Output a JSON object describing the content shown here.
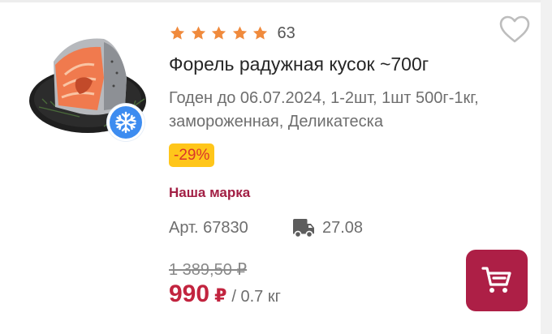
{
  "product": {
    "rating_count": "63",
    "rating_value": 5,
    "title": "Форель радужная кусок ~700г",
    "description": "Годен до 06.07.2024, 1-2шт, 1шт 500г-1кг, замороженная, Деликатеска",
    "discount": "-29%",
    "brand": "Наша марка",
    "article": "Арт. 67830",
    "delivery_date": "27.08",
    "old_price": "1 389,50 ₽",
    "price": "990",
    "currency": "₽",
    "price_unit": "/ 0.7 кг"
  },
  "icons": {
    "rating": "star-icon",
    "favorite": "heart-outline-icon",
    "frozen": "snowflake-icon",
    "delivery": "truck-icon",
    "cart": "cart-icon"
  },
  "colors": {
    "star": "#f08a3c",
    "discount_bg": "#ffc61a",
    "discount_text": "#d9362b",
    "brand": "#a21f44",
    "price": "#c2243f",
    "cart_button": "#ad1f46",
    "frozen_badge": "#3d8cf0"
  }
}
